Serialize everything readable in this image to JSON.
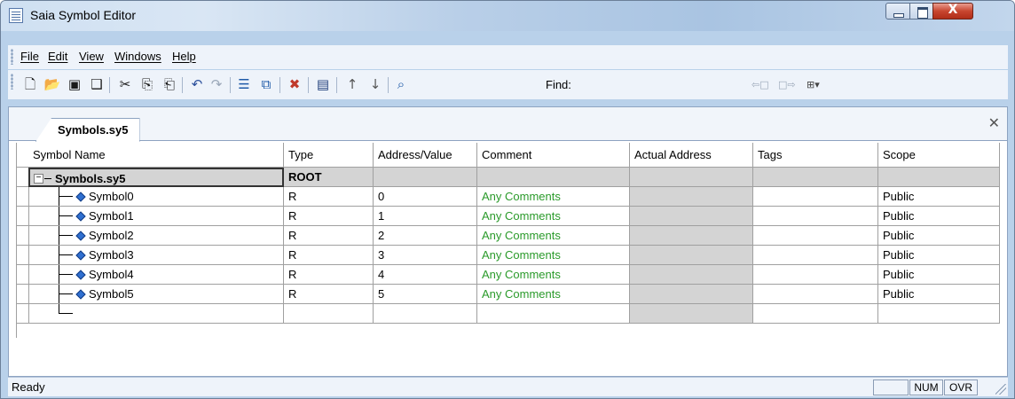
{
  "window": {
    "title": "Saia Symbol Editor"
  },
  "menu": {
    "items": [
      "File",
      "Edit",
      "View",
      "Windows",
      "Help"
    ]
  },
  "toolbar": {
    "icons": [
      "new-icon",
      "open-icon",
      "save-icon",
      "save-all-icon",
      "cut-icon",
      "copy-icon",
      "paste-icon",
      "undo-icon",
      "redo-icon",
      "insert-row-icon",
      "insert-group-icon",
      "delete-icon",
      "properties-icon",
      "move-up-icon",
      "move-down-icon",
      "find-icon"
    ],
    "find_label": "Find:",
    "find_value": ""
  },
  "document": {
    "tab_label": "Symbols.sy5",
    "columns": [
      "Symbol Name",
      "Type",
      "Address/Value",
      "Comment",
      "Actual Address",
      "Tags",
      "Scope"
    ],
    "root": {
      "name": "Symbols.sy5",
      "type": "ROOT",
      "expander": "−"
    },
    "rows": [
      {
        "name": "Symbol0",
        "type": "R",
        "address": "0",
        "comment": "Any Comments",
        "actual": "",
        "tags": "",
        "scope": "Public"
      },
      {
        "name": "Symbol1",
        "type": "R",
        "address": "1",
        "comment": "Any Comments",
        "actual": "",
        "tags": "",
        "scope": "Public"
      },
      {
        "name": "Symbol2",
        "type": "R",
        "address": "2",
        "comment": "Any Comments",
        "actual": "",
        "tags": "",
        "scope": "Public"
      },
      {
        "name": "Symbol3",
        "type": "R",
        "address": "3",
        "comment": "Any Comments",
        "actual": "",
        "tags": "",
        "scope": "Public"
      },
      {
        "name": "Symbol4",
        "type": "R",
        "address": "4",
        "comment": "Any Comments",
        "actual": "",
        "tags": "",
        "scope": "Public"
      },
      {
        "name": "Symbol5",
        "type": "R",
        "address": "5",
        "comment": "Any Comments",
        "actual": "",
        "tags": "",
        "scope": "Public"
      }
    ]
  },
  "status": {
    "text": "Ready",
    "num": "NUM",
    "ovr": "OVR"
  },
  "colors": {
    "comment": "#2a9a2a",
    "symbol_icon": "#2f6fd0",
    "grey_cell": "#d4d4d4"
  }
}
